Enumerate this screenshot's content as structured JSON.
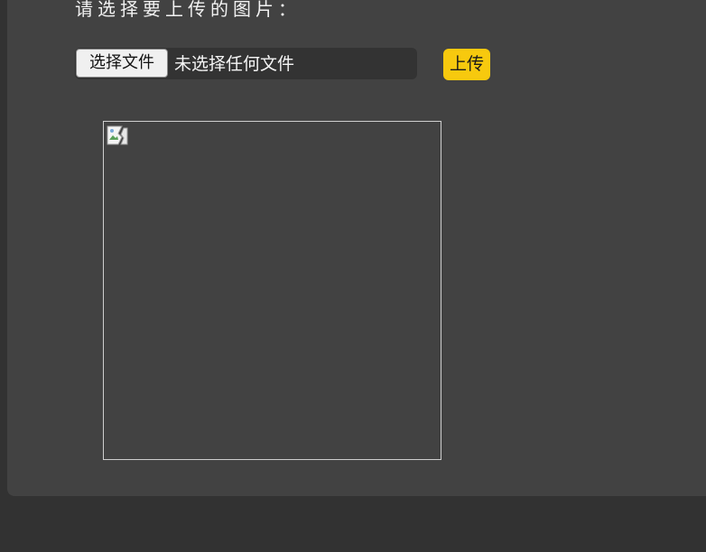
{
  "upload": {
    "prompt": "请选择要上传的图片：",
    "choose_file_label": "选择文件",
    "no_file_text": "未选择任何文件",
    "upload_label": "上传"
  },
  "preview": {
    "image_icon": "broken-image-icon"
  },
  "colors": {
    "page_background": "#323232",
    "panel_background": "#424242",
    "upload_button": "#f7c90e"
  }
}
